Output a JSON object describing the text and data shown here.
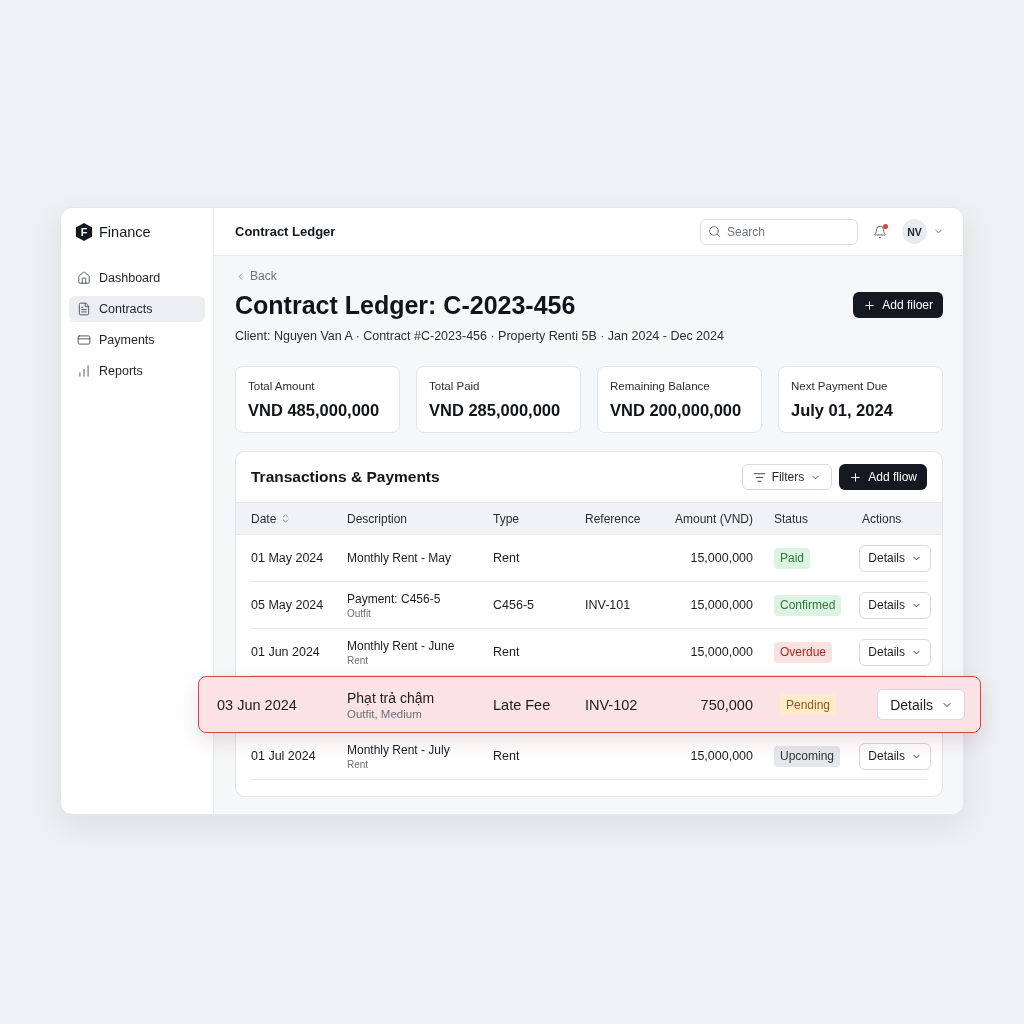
{
  "brand": {
    "logo_letter": "F",
    "name": "Finance"
  },
  "sidebar": {
    "items": [
      {
        "label": "Dashboard",
        "selected": false
      },
      {
        "label": "Contracts",
        "selected": true
      },
      {
        "label": "Payments",
        "selected": false
      },
      {
        "label": "Reports",
        "selected": false
      }
    ]
  },
  "header": {
    "title": "Contract Ledger",
    "search": {
      "placeholder": "Search"
    },
    "notifications": {
      "unread": true
    },
    "user": {
      "initials": "NV"
    }
  },
  "page": {
    "back": "Back",
    "title": "Contract Ledger: C-2023-456",
    "subtitle": "Client: Nguyen Van A · Contract #C-2023-456 · Property Renti 5B · Jan 2024 - Dec 2024",
    "primary_button": "Add filoer"
  },
  "stats": [
    {
      "label": "Total Amount",
      "value": "VND 485,000,000"
    },
    {
      "label": "Total Paid",
      "value": "VND 285,000,000"
    },
    {
      "label": "Remaining Balance",
      "value": "VND 200,000,000"
    },
    {
      "label": "Next Payment Due",
      "value": "July 01, 2024"
    }
  ],
  "transactions": {
    "title": "Transactions & Payments",
    "filter_button": "Filters",
    "add_button": "Add fliow",
    "columns": [
      {
        "label": "Date",
        "sortable": true
      },
      {
        "label": "Description",
        "sortable": false
      },
      {
        "label": "Type",
        "sortable": false
      },
      {
        "label": "Reference",
        "sortable": false
      },
      {
        "label": "Amount (VND)",
        "sortable": false
      },
      {
        "label": "Status",
        "sortable": false
      },
      {
        "label": "Actions",
        "sortable": false
      }
    ],
    "rows": [
      {
        "selected": false,
        "date": "01 May 2024",
        "description": "Monthly Rent - May",
        "type": "Rent",
        "amount": "15,000,000",
        "status": {
          "label": "Paid",
          "kind": "success"
        },
        "action": "Details"
      },
      {
        "selected": false,
        "date": "05 May 2024",
        "description": "Payment: C456-5",
        "note": "Outfit",
        "type": "C456-5",
        "reference": "INV-101",
        "amount": "15,000,000",
        "status": {
          "label": "Confirmed",
          "kind": "success"
        },
        "action": "Details"
      },
      {
        "selected": false,
        "date": "01 Jun 2024",
        "description": "Monthly Rent - June",
        "note": "Rent",
        "type": "Rent",
        "amount": "15,000,000",
        "status": {
          "label": "Overdue",
          "kind": "danger"
        },
        "action": "Details"
      },
      {
        "selected": true,
        "date": "03 Jun 2024",
        "description": "Phạt trả chậm",
        "note": "Outfit, Medium",
        "type": "Late Fee",
        "reference": "INV-102",
        "amount": "750,000",
        "status": {
          "label": "Pending",
          "kind": "warning"
        },
        "action": "Details"
      },
      {
        "selected": false,
        "date": "01 Jul 2024",
        "description": "Monthly Rent - July",
        "note": "Rent",
        "type": "Rent",
        "amount": "15,000,000",
        "status": {
          "label": "Upcoming",
          "kind": "neutral"
        },
        "action": "Details"
      }
    ]
  }
}
